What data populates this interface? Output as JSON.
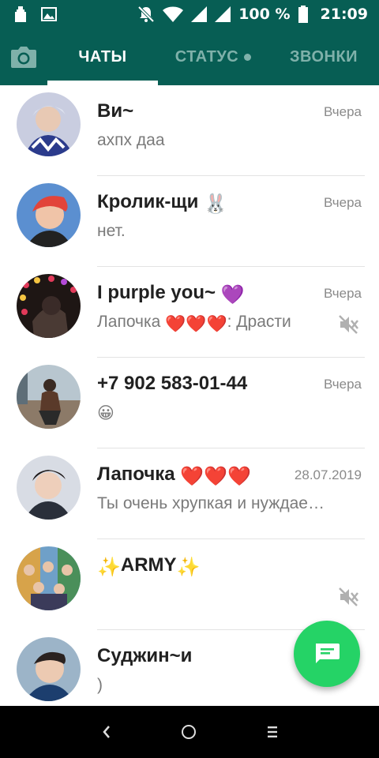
{
  "status_bar": {
    "battery": "100 %",
    "time": "21:09",
    "icons": [
      "usb-icon",
      "image-icon",
      "mute-notifications-icon",
      "wifi-icon",
      "signal-icon",
      "signal-icon",
      "battery-icon"
    ]
  },
  "tabs": {
    "camera_icon": "camera-icon",
    "items": [
      {
        "label": "ЧАТЫ",
        "active": true
      },
      {
        "label": "СТАТУС",
        "active": false,
        "has_dot": true
      },
      {
        "label": "ЗВОНКИ",
        "active": false
      }
    ]
  },
  "chats": [
    {
      "name": "Ви~",
      "time": "Вчера",
      "message": "ахпх даа",
      "muted": false
    },
    {
      "name": "Кролик-щи",
      "name_emoji": "🐰",
      "time": "Вчера",
      "message": "нет.",
      "muted": false
    },
    {
      "name": "I purple you~",
      "name_emoji": "💜",
      "time": "Вчера",
      "message_sender": "Лапочка",
      "message_sender_emoji": "❤️❤️❤️",
      "message": ": Драсти",
      "muted": true
    },
    {
      "name": "+7 902 583-01-44",
      "time": "Вчера",
      "message": "😀",
      "muted": false
    },
    {
      "name": "Лапочка",
      "name_emoji": "❤️❤️❤️",
      "time": "28.07.2019",
      "message": "Ты очень хрупкая и нуждае…",
      "muted": false
    },
    {
      "name_prefix_emoji": "✨",
      "name": "ARMY",
      "name_emoji": "✨",
      "time": "",
      "message": "",
      "muted": true
    },
    {
      "name": "Суджин~и",
      "time": "",
      "message": ")",
      "muted": false
    }
  ],
  "fab": {
    "icon": "new-chat-icon"
  },
  "colors": {
    "header": "#075e54",
    "accent": "#25d366",
    "tab_inactive": "#7fb1aa"
  }
}
